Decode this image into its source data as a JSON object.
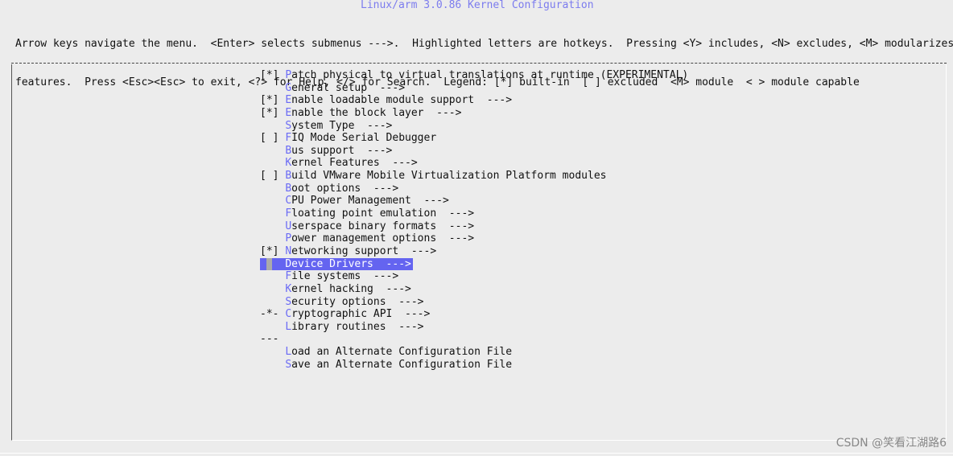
{
  "title": "Linux/arm 3.0.86 Kernel Configuration",
  "help_lines": [
    "Arrow keys navigate the menu.  <Enter> selects submenus --->.  Highlighted letters are hotkeys.  Pressing <Y> includes, <N> excludes, <M> modularizes",
    "features.  Press <Esc><Esc> to exit, <?> for Help, </> for Search.  Legend: [*] built-in  [ ] excluded  <M> module  < > module capable"
  ],
  "menu": [
    {
      "prefix": "[*] ",
      "hot": "P",
      "rest": "atch physical to virtual translations at runtime (EXPERIMENTAL)"
    },
    {
      "prefix": "    ",
      "hot": "G",
      "rest": "eneral setup  --->"
    },
    {
      "prefix": "[*] ",
      "hot": "E",
      "rest": "nable loadable module support  --->"
    },
    {
      "prefix": "[*] ",
      "hot": "E",
      "rest": "nable the block layer  --->"
    },
    {
      "prefix": "    ",
      "hot": "S",
      "rest": "ystem Type  --->"
    },
    {
      "prefix": "[ ] ",
      "hot": "F",
      "rest": "IQ Mode Serial Debugger"
    },
    {
      "prefix": "    ",
      "hot": "B",
      "rest": "us support  --->"
    },
    {
      "prefix": "    ",
      "hot": "K",
      "rest": "ernel Features  --->"
    },
    {
      "prefix": "[ ] ",
      "hot": "B",
      "rest": "uild VMware Mobile Virtualization Platform modules"
    },
    {
      "prefix": "    ",
      "hot": "B",
      "rest": "oot options  --->"
    },
    {
      "prefix": "    ",
      "hot": "C",
      "rest": "PU Power Management  --->"
    },
    {
      "prefix": "    ",
      "hot": "F",
      "rest": "loating point emulation  --->"
    },
    {
      "prefix": "    ",
      "hot": "U",
      "rest": "serspace binary formats  --->"
    },
    {
      "prefix": "    ",
      "hot": "P",
      "rest": "ower management options  --->"
    },
    {
      "prefix": "[*] ",
      "hot": "N",
      "rest": "etworking support  --->"
    },
    {
      "prefix": "    ",
      "hot": "D",
      "rest": "evice Drivers  --->",
      "selected": true
    },
    {
      "prefix": "    ",
      "hot": "F",
      "rest": "ile systems  --->"
    },
    {
      "prefix": "    ",
      "hot": "K",
      "rest": "ernel hacking  --->"
    },
    {
      "prefix": "    ",
      "hot": "S",
      "rest": "ecurity options  --->"
    },
    {
      "prefix": "-*- ",
      "hot": "C",
      "rest": "ryptographic API  --->"
    },
    {
      "prefix": "    ",
      "hot": "L",
      "rest": "ibrary routines  --->"
    },
    {
      "prefix": "---",
      "hot": "",
      "rest": ""
    },
    {
      "prefix": "    ",
      "hot": "L",
      "rest": "oad an Alternate Configuration File"
    },
    {
      "prefix": "    ",
      "hot": "S",
      "rest": "ave an Alternate Configuration File"
    }
  ],
  "watermark": "CSDN @笑看江湖路6",
  "colors": {
    "hotkey": "#6a6af5",
    "selection": "#6464f0",
    "background": "#ececec"
  }
}
